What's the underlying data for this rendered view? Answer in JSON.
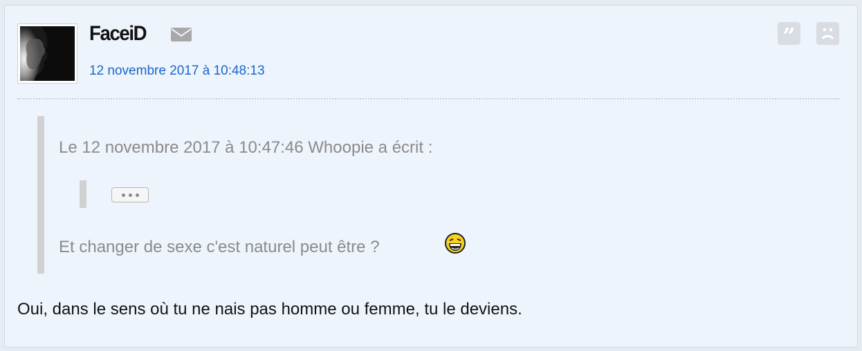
{
  "post": {
    "author": "FaceiD",
    "date": "12 novembre 2017 à 10:48:13",
    "quote": {
      "header": "Le 12 novembre 2017 à 10:47:46 Whoopie a écrit :",
      "text": "Et changer de sexe c'est naturel peut être ?"
    },
    "reply_text": "Oui, dans le sens où tu ne nais pas homme ou femme, tu le deviens."
  },
  "icons": {
    "mail": "envelope-icon",
    "quote": "quote-icon",
    "report": "sad-face-icon",
    "smiley": "laughing-smiley-icon",
    "expand": "ellipsis-icon"
  },
  "colors": {
    "background": "#eef4fc",
    "date_link": "#1a66c9",
    "quote_text": "#8a8a8a",
    "quote_bar": "#d1d1d1"
  }
}
